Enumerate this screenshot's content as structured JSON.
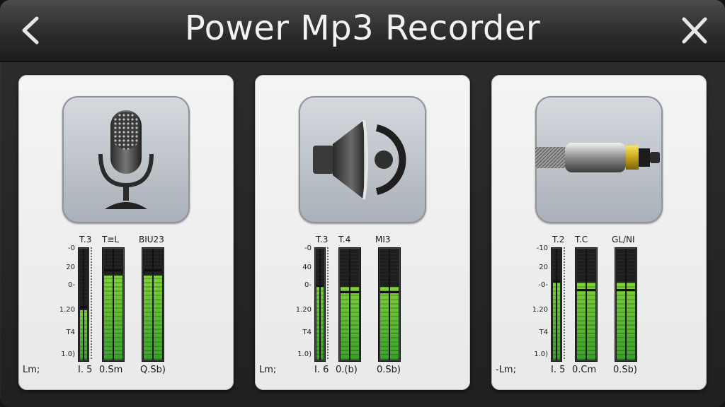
{
  "window": {
    "title": "Power Mp3 Recorder"
  },
  "icons": {
    "back": "chevron-left-icon",
    "close": "close-icon"
  },
  "colors": {
    "meter_green": "#5dbb30",
    "meter_bg": "#1e1e1e",
    "card_bg": "#eeeeee"
  },
  "sources": [
    {
      "name": "microphone",
      "icon": "microphone-icon",
      "col_labels": [
        "T.3",
        "T≡L",
        "BIU23"
      ],
      "scale": [
        "-0",
        "20",
        "0-",
        "1.20",
        "T4",
        "1.0)"
      ],
      "bottom_labels": [
        "Lm;",
        "I. 5",
        "0.Sm",
        "Q.Sb)"
      ],
      "levels": [
        0.45,
        0.76,
        0.76
      ],
      "peaks": [
        0.47,
        0.8,
        0.8
      ]
    },
    {
      "name": "speaker",
      "icon": "speaker-icon",
      "col_labels": [
        "T.3",
        "T.4",
        "MI3"
      ],
      "scale": [
        "-0",
        "40",
        "0-",
        "1.20",
        "T4",
        "1.0)"
      ],
      "bottom_labels": [
        "Lm;",
        "I. 6",
        "0.(b)",
        "0.Sb)"
      ],
      "levels": [
        0.66,
        0.66,
        0.66
      ],
      "peaks": [
        0.66,
        0.6,
        0.6
      ]
    },
    {
      "name": "line-in",
      "icon": "audio-jack-icon",
      "col_labels": [
        "T.2",
        "T.C",
        "GL/NI"
      ],
      "scale": [
        "-10",
        "20",
        "-0-",
        "1.20",
        "T4",
        "1.0)"
      ],
      "bottom_labels": [
        "-Lm;",
        "I. 5",
        "0.Cm",
        "0.Sb)"
      ],
      "levels": [
        0.7,
        0.7,
        0.7
      ],
      "peaks": [
        0.7,
        0.62,
        0.62
      ]
    }
  ]
}
